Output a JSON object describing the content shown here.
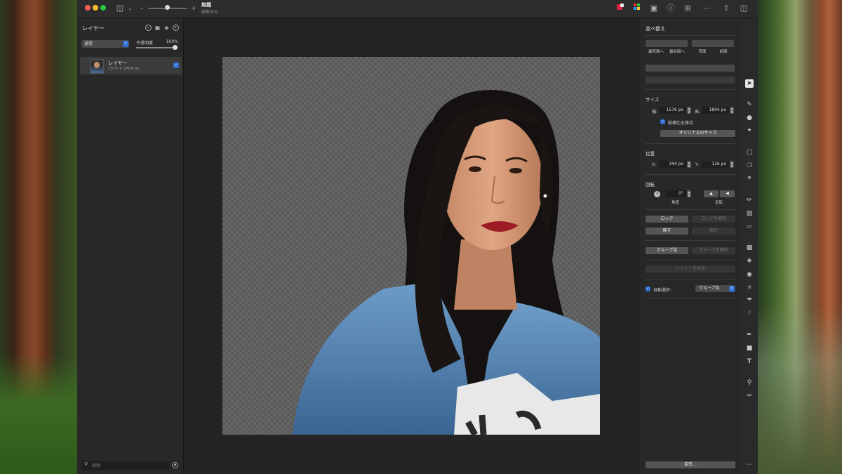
{
  "titlebar": {
    "doc_title": "無題",
    "doc_subtitle": "編集済み"
  },
  "layers_panel": {
    "title": "レイヤー",
    "blend_mode": "通常",
    "opacity_label": "不透明度",
    "opacity_value": "100%",
    "opacity_fraction": 1.0,
    "layers": [
      {
        "name": "レイヤー",
        "dimensions": "1576 × 1804 px",
        "visible": true
      }
    ],
    "search_placeholder": "検索"
  },
  "inspector": {
    "arrange_title": "並べ替え",
    "arrange_buttons": [
      "最背面へ",
      "最前面へ",
      "背面",
      "前面"
    ],
    "size_label": "サイズ",
    "width_label": "幅:",
    "width_value": "1576 px",
    "height_label": "高:",
    "height_value": "1804 px",
    "keep_aspect_label": "縦横比を維持",
    "original_size_button": "オリジナルのサイズ",
    "position_label": "位置",
    "x_label": "X:",
    "x_value": "344 px",
    "y_label": "Y:",
    "y_value": "116 px",
    "rotation_label": "回転",
    "angle_value": "0°",
    "angle_caption": "角度",
    "flip_caption": "反転",
    "lock_button": "ロック",
    "unlock_button": "ロックを解除",
    "hide_button": "隠す",
    "show_button": "表示",
    "group_button": "グループ化",
    "ungroup_button": "グループを解除",
    "merge_button": "レイヤーを結合",
    "auto_select_label": "自動選択:",
    "auto_select_value": "グループ化",
    "transform_button": "変形..."
  },
  "tools": [
    "arrow-icon",
    "retouch-icon",
    "clone-icon",
    "effects-icon",
    "rect-select-icon",
    "lasso-icon",
    "magic-wand-icon",
    "brush-icon",
    "fill-icon",
    "eraser-icon",
    "bandage-icon",
    "blur-icon",
    "sponge-icon",
    "sun-icon",
    "burn-icon",
    "finger-icon",
    "pen-icon",
    "shape-icon",
    "text-icon",
    "zoom-icon",
    "eyedropper-icon",
    "more-icon"
  ]
}
